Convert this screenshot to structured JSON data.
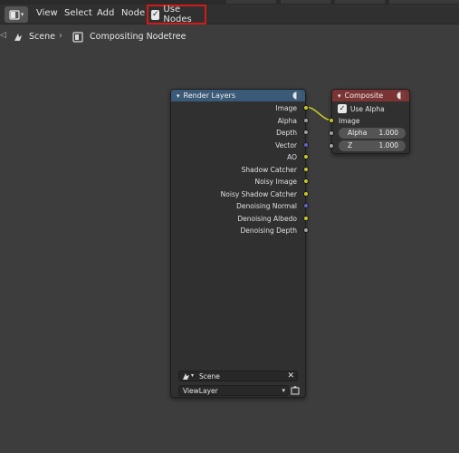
{
  "header": {
    "editor_type_icon": "compositor-icon",
    "menu": [
      "View",
      "Select",
      "Add",
      "Node"
    ],
    "use_nodes": {
      "label": "Use Nodes",
      "checked": true
    }
  },
  "breadcrumb": {
    "scene": "Scene",
    "nodetree": "Compositing Nodetree"
  },
  "nodes": {
    "render_layers": {
      "title": "Render Layers",
      "outputs": [
        {
          "label": "Image",
          "color": "#c7c729"
        },
        {
          "label": "Alpha",
          "color": "#a1a1a1"
        },
        {
          "label": "Depth",
          "color": "#a1a1a1"
        },
        {
          "label": "Vector",
          "color": "#6363c7"
        },
        {
          "label": "AO",
          "color": "#c7c729"
        },
        {
          "label": "Shadow Catcher",
          "color": "#c7c729"
        },
        {
          "label": "Noisy Image",
          "color": "#c7c729"
        },
        {
          "label": "Noisy Shadow Catcher",
          "color": "#c7c729"
        },
        {
          "label": "Denoising Normal",
          "color": "#6363c7"
        },
        {
          "label": "Denoising Albedo",
          "color": "#c7c729"
        },
        {
          "label": "Denoising Depth",
          "color": "#a1a1a1"
        }
      ],
      "scene_field": "Scene",
      "view_layer_field": "ViewLayer",
      "header_color": "#3a5a78"
    },
    "composite": {
      "title": "Composite",
      "use_alpha": {
        "label": "Use Alpha",
        "checked": true
      },
      "input_image_label": "Image",
      "alpha": {
        "label": "Alpha",
        "value": "1.000"
      },
      "z": {
        "label": "Z",
        "value": "1.000"
      },
      "header_color": "#7a3434"
    }
  },
  "link_color": "#c7c729"
}
